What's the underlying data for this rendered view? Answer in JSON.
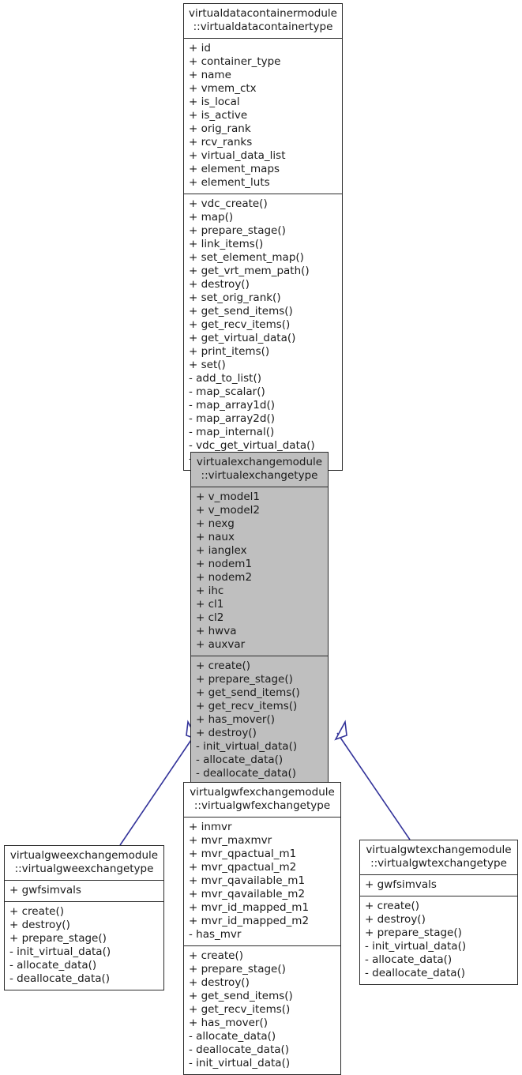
{
  "diagram": {
    "type": "uml-class-inheritance",
    "title": "",
    "colors": {
      "box_border": "#2b2b2b",
      "box_fill_default": "#ffffff",
      "box_fill_highlight": "#bfbfbf",
      "edge": "#33339a",
      "text": "#1a1a1a"
    }
  },
  "classes": [
    {
      "id": "virtualdatacontainertype",
      "name": "virtualdatacontainermodule\n::virtualdatacontainertype",
      "highlighted": false,
      "attributes": [
        "+ id",
        "+ container_type",
        "+ name",
        "+ vmem_ctx",
        "+ is_local",
        "+ is_active",
        "+ orig_rank",
        "+ rcv_ranks",
        "+ virtual_data_list",
        "+ element_maps",
        "+ element_luts"
      ],
      "methods": [
        "+ vdc_create()",
        "+ map()",
        "+ prepare_stage()",
        "+ link_items()",
        "+ set_element_map()",
        "+ get_vrt_mem_path()",
        "+ destroy()",
        "+ set_orig_rank()",
        "+ get_send_items()",
        "+ get_recv_items()",
        "+ get_virtual_data()",
        "+ print_items()",
        "+ set()",
        "- add_to_list()",
        "- map_scalar()",
        "- map_array1d()",
        "- map_array2d()",
        "- map_internal()",
        "- vdc_get_virtual_data()",
        "- get_items_for_stage()"
      ]
    },
    {
      "id": "virtualexchangetype",
      "name": "virtualexchangemodule\n::virtualexchangetype",
      "highlighted": true,
      "attributes": [
        "+ v_model1",
        "+ v_model2",
        "+ nexg",
        "+ naux",
        "+ ianglex",
        "+ nodem1",
        "+ nodem2",
        "+ ihc",
        "+ cl1",
        "+ cl2",
        "+ hwva",
        "+ auxvar"
      ],
      "methods": [
        "+ create()",
        "+ prepare_stage()",
        "+ get_send_items()",
        "+ get_recv_items()",
        "+ has_mover()",
        "+ destroy()",
        "- init_virtual_data()",
        "- allocate_data()",
        "- deallocate_data()"
      ]
    },
    {
      "id": "virtualgweexchangetype",
      "name": "virtualgweexchangemodule\n::virtualgweexchangetype",
      "highlighted": false,
      "attributes": [
        "+ gwfsimvals"
      ],
      "methods": [
        "+ create()",
        "+ destroy()",
        "+ prepare_stage()",
        "- init_virtual_data()",
        "- allocate_data()",
        "- deallocate_data()"
      ]
    },
    {
      "id": "virtualgwfexchangetype",
      "name": "virtualgwfexchangemodule\n::virtualgwfexchangetype",
      "highlighted": false,
      "attributes": [
        "+ inmvr",
        "+ mvr_maxmvr",
        "+ mvr_qpactual_m1",
        "+ mvr_qpactual_m2",
        "+ mvr_qavailable_m1",
        "+ mvr_qavailable_m2",
        "+ mvr_id_mapped_m1",
        "+ mvr_id_mapped_m2",
        "- has_mvr"
      ],
      "methods": [
        "+ create()",
        "+ prepare_stage()",
        "+ destroy()",
        "+ get_send_items()",
        "+ get_recv_items()",
        "+ has_mover()",
        "- allocate_data()",
        "- deallocate_data()",
        "- init_virtual_data()"
      ]
    },
    {
      "id": "virtualgwtexchangetype",
      "name": "virtualgwtexchangemodule\n::virtualgwtexchangetype",
      "highlighted": false,
      "attributes": [
        "+ gwfsimvals"
      ],
      "methods": [
        "+ create()",
        "+ destroy()",
        "+ prepare_stage()",
        "- init_virtual_data()",
        "- allocate_data()",
        "- deallocate_data()"
      ]
    }
  ],
  "edges": [
    {
      "from": "virtualexchangetype",
      "to": "virtualdatacontainertype",
      "kind": "inheritance"
    },
    {
      "from": "virtualgweexchangetype",
      "to": "virtualexchangetype",
      "kind": "inheritance"
    },
    {
      "from": "virtualgwfexchangetype",
      "to": "virtualexchangetype",
      "kind": "inheritance"
    },
    {
      "from": "virtualgwtexchangetype",
      "to": "virtualexchangetype",
      "kind": "inheritance"
    }
  ]
}
